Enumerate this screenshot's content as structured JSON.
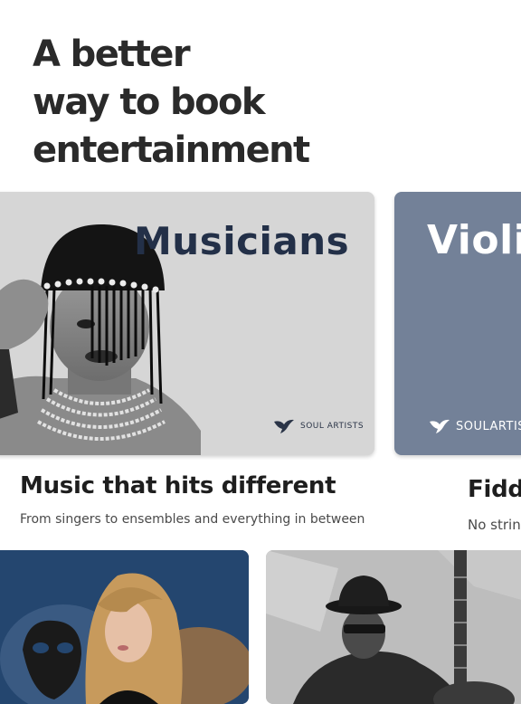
{
  "hero": {
    "title_lines": [
      "A better",
      "way to book",
      "entertainment"
    ]
  },
  "cards": [
    {
      "title": "Musicians",
      "brand": "SOUL ARTISTS",
      "brand_icon": "bird-logo-icon",
      "headline": "Music that hits different",
      "subtitle": "From singers to ensembles and everything in between",
      "background": "#d6d6d6",
      "title_color": "#233048"
    },
    {
      "title": "Violi",
      "brand": "SOULARTISTS",
      "brand_icon": "bird-logo-icon",
      "headline": "Fidd",
      "subtitle": "No strin",
      "background": "#738198",
      "title_color": "#ffffff"
    }
  ],
  "tiles": [
    {
      "image": "singer-with-mask-photo"
    },
    {
      "image": "guitarist-with-hat-photo"
    }
  ]
}
